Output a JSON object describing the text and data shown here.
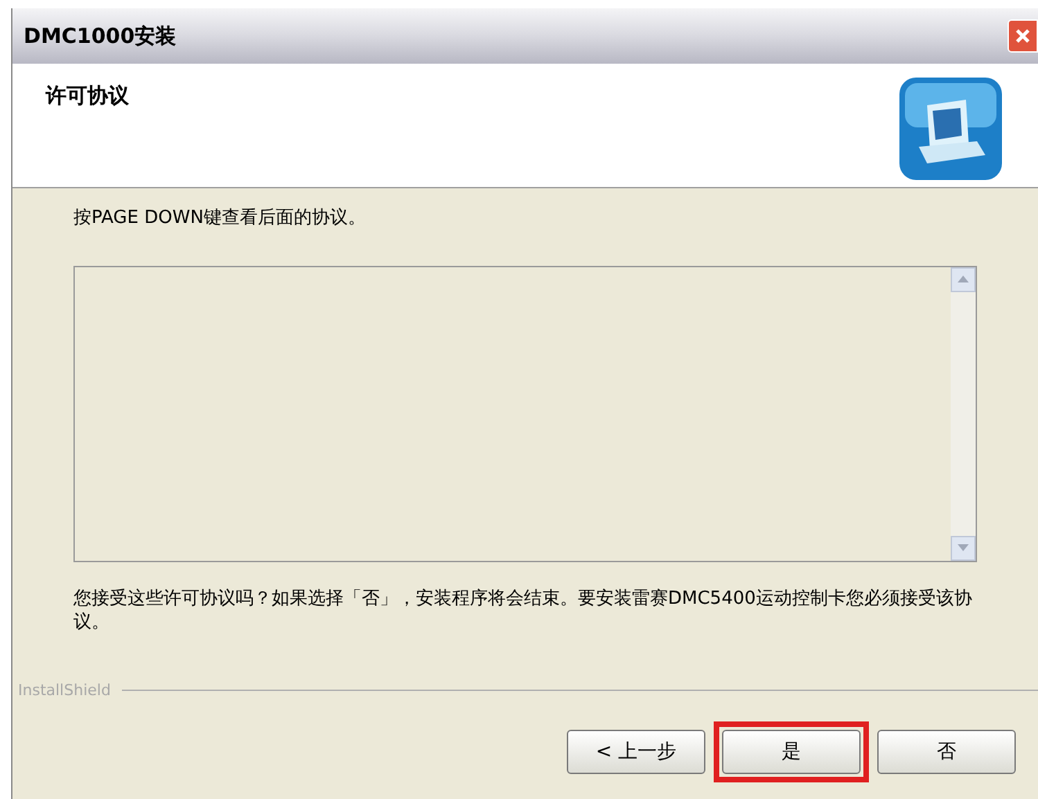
{
  "window": {
    "title": "DMC1000安装"
  },
  "header": {
    "title": "许可协议"
  },
  "instruction": "按PAGE DOWN键查看后面的协议。",
  "question": "您接受这些许可协议吗？如果选择「否」，安装程序将会结束。要安装雷赛DMC5400运动控制卡您必须接受该协议。",
  "brand": "InstallShield",
  "buttons": [
    {
      "label": "< 上一步",
      "highlighted": false
    },
    {
      "label": "是",
      "highlighted": true
    },
    {
      "label": "否",
      "highlighted": false
    }
  ]
}
